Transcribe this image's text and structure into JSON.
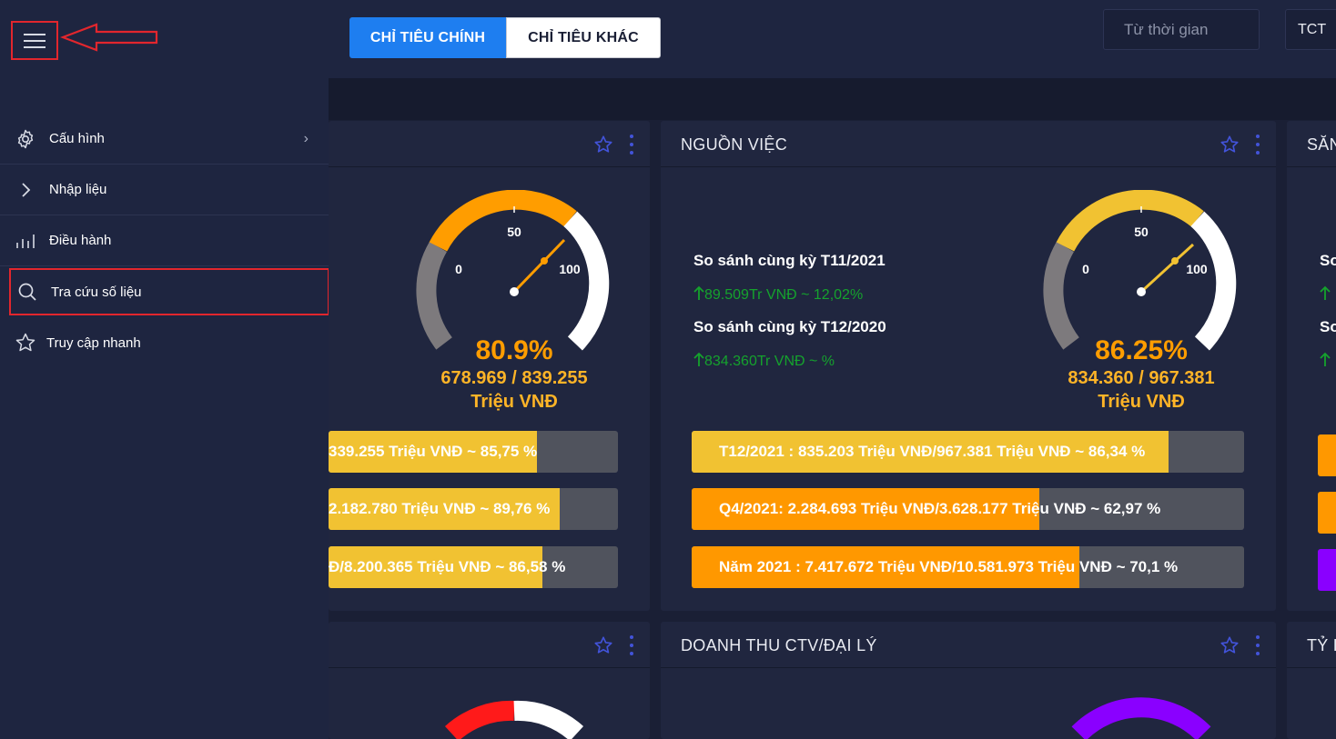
{
  "header": {
    "tabs": [
      {
        "label": "CHỈ TIÊU CHÍNH",
        "active": true
      },
      {
        "label": "CHỈ TIÊU KHÁC",
        "active": false
      }
    ],
    "date_placeholder": "Từ thời gian",
    "org_value": "TCT"
  },
  "sidebar": {
    "items": [
      {
        "label": "Cấu hình",
        "icon": "gear-icon",
        "chevron": "›"
      },
      {
        "label": "Nhập liệu",
        "icon": "chevron-right-icon"
      },
      {
        "label": "Điều hành",
        "icon": "bar-chart-icon"
      },
      {
        "label": "Tra cứu số liệu",
        "icon": "search-icon"
      },
      {
        "label": "Truy cập nhanh",
        "icon": "star-icon"
      }
    ]
  },
  "cards": {
    "card1": {
      "gauge": {
        "min_label": "0",
        "mid_label": "50",
        "max_label": "100",
        "percent": "80.9%",
        "ratio": "678.969 / 839.255",
        "unit": "Triệu VNĐ"
      },
      "bars": [
        {
          "text": "339.255 Triệu VNĐ ~ 85,75 %",
          "fill": 0.72
        },
        {
          "text": "2.182.780 Triệu VNĐ ~ 89,76 %",
          "fill": 0.8
        },
        {
          "text": "Đ/8.200.365 Triệu VNĐ ~ 86,58 %",
          "fill": 0.74
        }
      ]
    },
    "card2": {
      "title": "NGUỒN VIỆC",
      "compare": [
        {
          "title": "So sánh cùng kỳ T11/2021",
          "value": "89.509Tr VNĐ ~ 12,02%"
        },
        {
          "title": "So sánh cùng kỳ T12/2020",
          "value": "834.360Tr VNĐ ~ %"
        }
      ],
      "gauge": {
        "min_label": "0",
        "mid_label": "50",
        "max_label": "100",
        "percent": "86.25%",
        "ratio": "834.360 / 967.381",
        "unit": "Triệu VNĐ"
      },
      "bars": [
        {
          "text": "T12/2021 : 835.203 Triệu VNĐ/967.381 Triệu VNĐ ~ 86,34 %",
          "fill": 0.863
        },
        {
          "text": "Q4/2021: 2.284.693 Triệu VNĐ/3.628.177 Triệu VNĐ ~ 62,97 %",
          "fill": 0.63
        },
        {
          "text": "Năm 2021 : 7.417.672 Triệu VNĐ/10.581.973 Triệu VNĐ ~ 70,1 %",
          "fill": 0.701
        }
      ]
    },
    "card3": {
      "title": "SĂN",
      "compare_titles": [
        "So",
        "So"
      ]
    },
    "card5": {
      "title": "DOANH THU CTV/ĐẠI LÝ"
    },
    "card6": {
      "title": "TỶ L"
    }
  },
  "colors": {
    "accent_blue": "#1e7ef0",
    "gauge_orange": "#ff9d00",
    "gauge_yellow": "#f1c232",
    "bar_yellow": "#f1c232",
    "bar_orange": "#ff9800",
    "bar_purple": "#8a00ff",
    "gauge_red": "#ff1a1a",
    "trend_green": "#15a22d",
    "annotation_red": "#e2262d"
  }
}
